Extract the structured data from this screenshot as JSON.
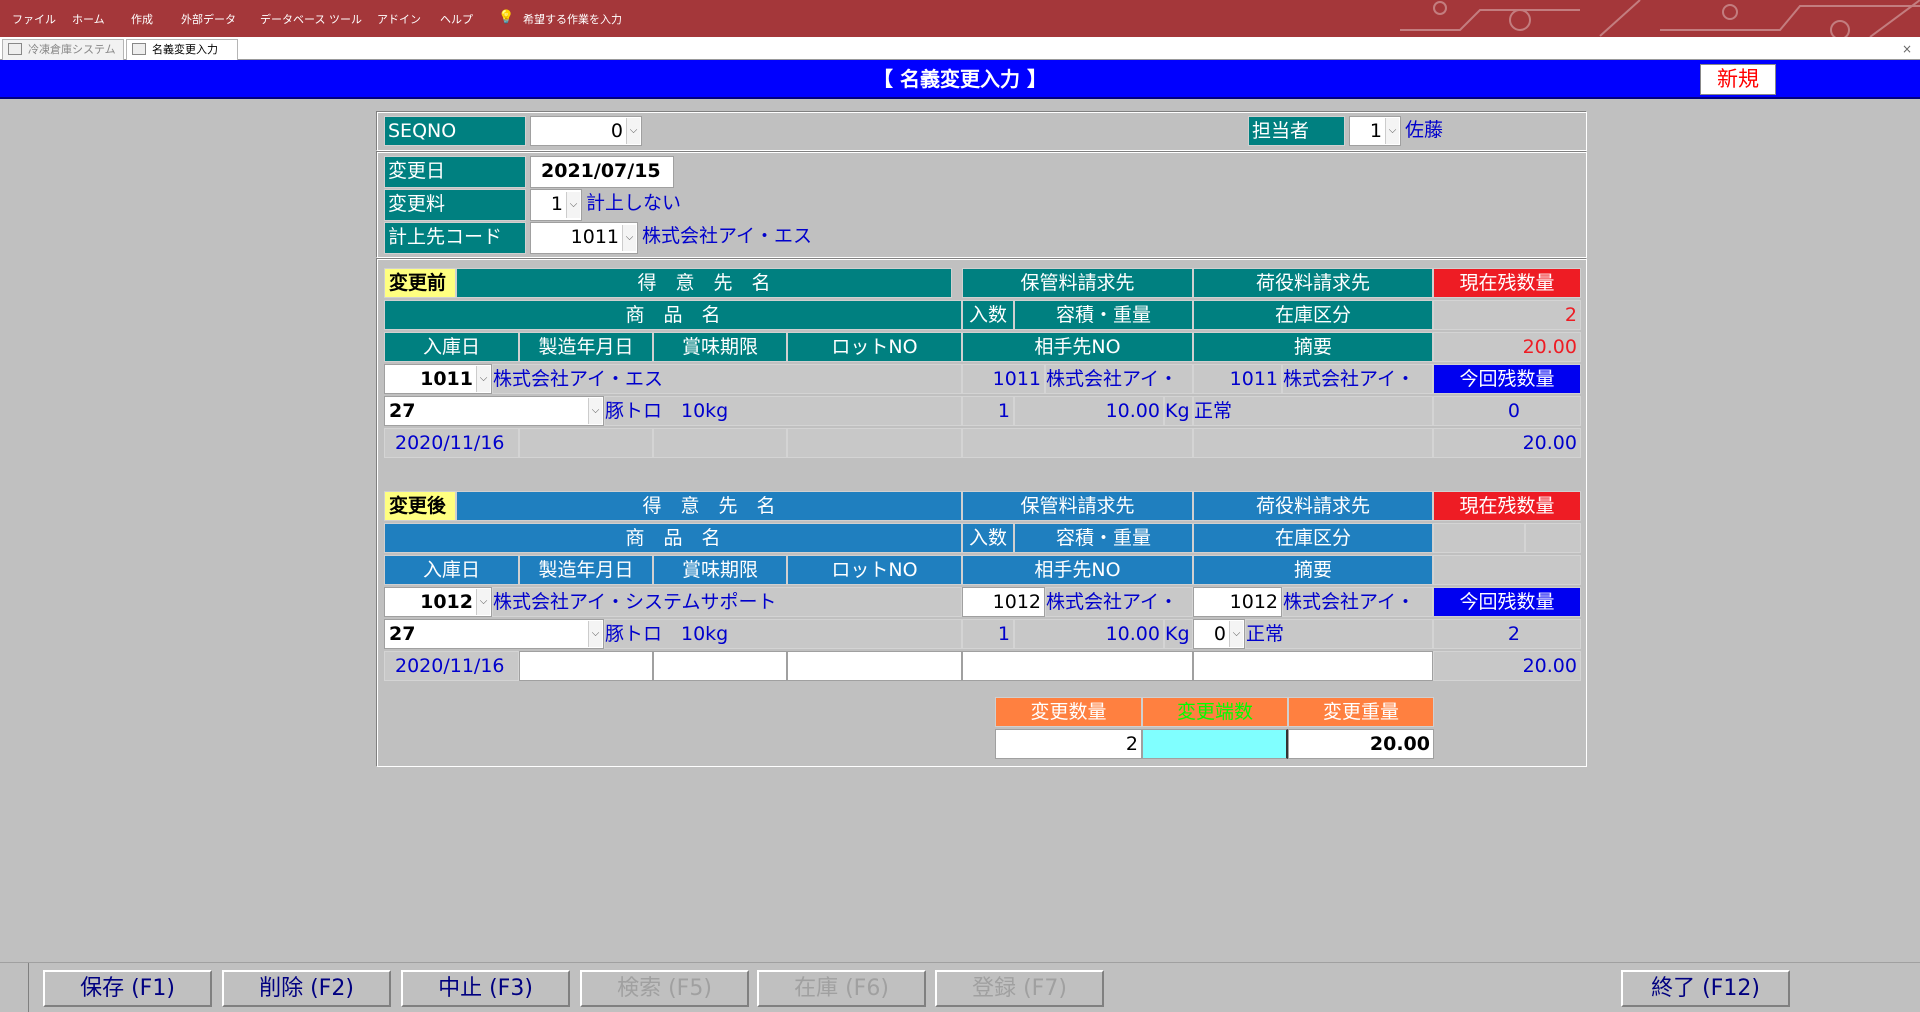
{
  "ribbon": {
    "menu": [
      "ファイル",
      "ホーム",
      "作成",
      "外部データ",
      "データベース ツール",
      "アドイン",
      "ヘルプ"
    ],
    "search_hint": "希望する作業を入力"
  },
  "tabs": [
    {
      "label": "冷凍倉庫システム"
    },
    {
      "label": "名義変更入力"
    }
  ],
  "tab_close": "×",
  "form": {
    "title": "【 名義変更入力 】",
    "mode": "新規"
  },
  "top": {
    "seqno_label": "SEQNO",
    "seqno": "0",
    "staff_label": "担当者",
    "staff_code": "1",
    "staff_name": "佐藤"
  },
  "info": {
    "date_label": "変更日",
    "date": "2021/07/15",
    "fee_label": "変更料",
    "fee_code": "1",
    "fee_text": "計上しない",
    "acct_label": "計上先コード",
    "acct_code": "1011",
    "acct_name": "株式会社アイ・エス"
  },
  "headers": {
    "customer": "得　意　先　名",
    "storage_bill": "保管料請求先",
    "handling_bill": "荷役料請求先",
    "current_qty": "現在残数量",
    "product": "商　品　名",
    "units": "入数",
    "volume": "容積・重量",
    "stock_type": "在庫区分",
    "in_date": "入庫日",
    "mfg_date": "製造年月日",
    "best_before": "賞味期限",
    "lot": "ロットNO",
    "partner_no": "相手先NO",
    "memo": "摘要",
    "this_qty": "今回残数量"
  },
  "before": {
    "tag": "変更前",
    "cust_code": "1011",
    "cust_name": "株式会社アイ・エス",
    "storage_code": "1011",
    "storage_name": "株式会社アイ・",
    "handling_code": "1011",
    "handling_name": "株式会社アイ・",
    "cur_qty": "2",
    "cur_weight": "20.00",
    "this_qty": "0",
    "this_weight": "20.00",
    "product_code": "27",
    "product_name": "豚トロ　10kg",
    "units": "1",
    "weight": "10.00",
    "unit": "Kg",
    "stock_type": "正常",
    "in_date": "2020/11/16"
  },
  "after": {
    "tag": "変更後",
    "cust_code": "1012",
    "cust_name": "株式会社アイ・システムサポート",
    "storage_code": "1012",
    "storage_name": "株式会社アイ・",
    "handling_code": "1012",
    "handling_name": "株式会社アイ・",
    "this_qty": "2",
    "this_weight": "20.00",
    "product_code": "27",
    "product_name": "豚トロ　10kg",
    "units": "1",
    "weight": "10.00",
    "unit": "Kg",
    "stock_code": "0",
    "stock_type": "正常",
    "in_date": "2020/11/16"
  },
  "change": {
    "qty_label": "変更数量",
    "frac_label": "変更端数",
    "weight_label": "変更重量",
    "qty": "2",
    "frac": "",
    "weight": "20.00"
  },
  "fkeys": [
    {
      "label": "保存 (F1)",
      "enabled": true
    },
    {
      "label": "削除 (F2)",
      "enabled": true
    },
    {
      "label": "中止 (F3)",
      "enabled": true
    },
    {
      "label": "検索 (F5)",
      "enabled": false
    },
    {
      "label": "在庫 (F6)",
      "enabled": false
    },
    {
      "label": "登録 (F7)",
      "enabled": false
    },
    {
      "label": "終了 (F12)",
      "enabled": true
    }
  ],
  "colors": {
    "ribbon": "#a4373a",
    "title_bar": "#0000ff",
    "teal": "#008080",
    "after_header": "#1f7fbf",
    "alert_red": "#ee1c24",
    "label_yellow": "#ffff80",
    "change_orange": "#ff8040",
    "frac_cyan": "#80ffff"
  }
}
